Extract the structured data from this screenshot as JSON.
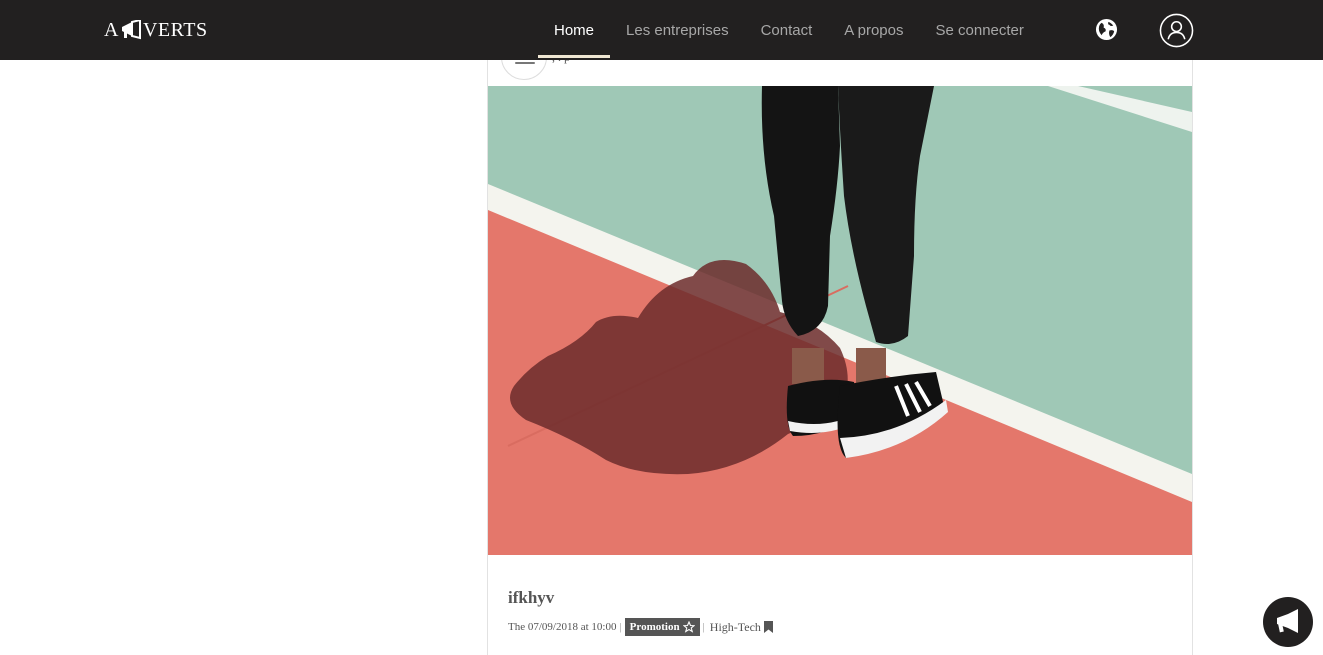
{
  "brand": {
    "prefix": "A",
    "suffix": "VERTS"
  },
  "nav": {
    "items": [
      {
        "label": "Home",
        "active": true
      },
      {
        "label": "Les entreprises",
        "active": false
      },
      {
        "label": "Contact",
        "active": false
      },
      {
        "label": "A propos",
        "active": false
      },
      {
        "label": "Se connecter",
        "active": false
      }
    ],
    "globe_icon": "globe-icon",
    "user_icon": "user-account-icon"
  },
  "post": {
    "title": "ifkhyv",
    "date": "The 07/09/2018 at 10:00",
    "separator": "|",
    "badge": "Promotion",
    "category": "High-Tech",
    "header_text": ", . p"
  },
  "colors": {
    "navbar": "#222020",
    "nav_active_underline": "#efe6d2",
    "badge": "#555555",
    "court_red": "#e4776b",
    "court_green": "#9fc8b6"
  },
  "fab": {
    "icon": "megaphone-icon"
  }
}
